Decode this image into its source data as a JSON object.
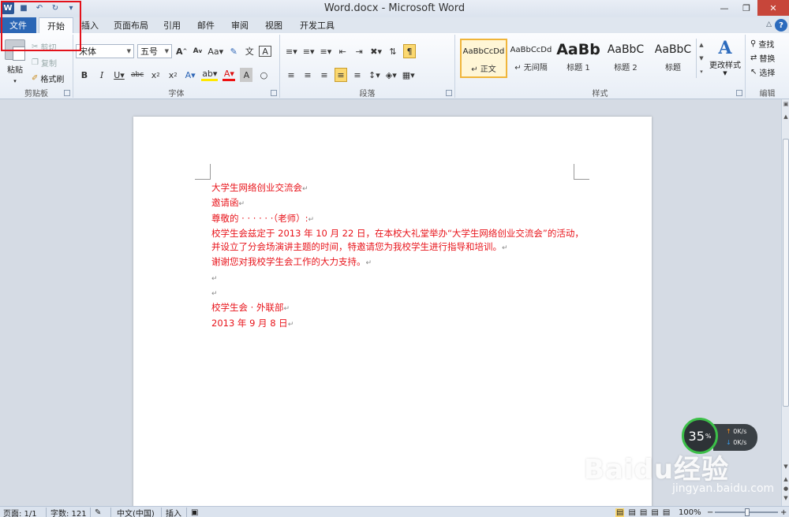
{
  "window": {
    "title": "Word.docx - Microsoft Word"
  },
  "tabs": {
    "file": "文件",
    "home": "开始",
    "insert": "插入",
    "layout": "页面布局",
    "references": "引用",
    "mailings": "邮件",
    "review": "审阅",
    "view": "视图",
    "developer": "开发工具"
  },
  "ribbon": {
    "clipboard": {
      "paste": "粘贴",
      "cut": "剪切",
      "copy": "复制",
      "format_painter": "格式刷",
      "label": "剪贴板"
    },
    "font": {
      "font_name": "宋体",
      "font_size": "五号",
      "label": "字体"
    },
    "paragraph": {
      "label": "段落"
    },
    "styles": {
      "items": [
        {
          "sample": "AaBbCcDd",
          "name": "↵ 正文"
        },
        {
          "sample": "AaBbCcDd",
          "name": "↵ 无间隔"
        },
        {
          "sample": "AaBb",
          "name": "标题 1"
        },
        {
          "sample": "AaBbC",
          "name": "标题 2"
        },
        {
          "sample": "AaBbC",
          "name": "标题"
        }
      ],
      "change_styles": "更改样式",
      "label": "样式"
    },
    "editing": {
      "find": "查找",
      "replace": "替换",
      "select": "选择",
      "label": "编辑"
    }
  },
  "document": {
    "lines": [
      "大学生网络创业交流会",
      "邀请函",
      "尊敬的 · · · · · ·（老师）:",
      "校学生会兹定于 2013 年 10 月 22 日，在本校大礼堂举办“大学生网络创业交流会”的活动，",
      "并设立了分会场演讲主题的时间，特邀请您为我校学生进行指导和培训。",
      "谢谢您对我校学生会工作的大力支持。",
      "",
      "",
      "校学生会 · 外联部",
      "2013 年 9 月 8 日"
    ],
    "text_color": "#e8141b"
  },
  "net_widget": {
    "percent": "35",
    "percent_sign": "%",
    "up": "0K/s",
    "down": "0K/s"
  },
  "watermark": {
    "logo": "Baidu经验",
    "url": "jingyan.baidu.com"
  },
  "statusbar": {
    "page": "页面: 1/1",
    "words": "字数: 121",
    "language": "中文(中国)",
    "mode": "插入",
    "zoom": "100%"
  }
}
